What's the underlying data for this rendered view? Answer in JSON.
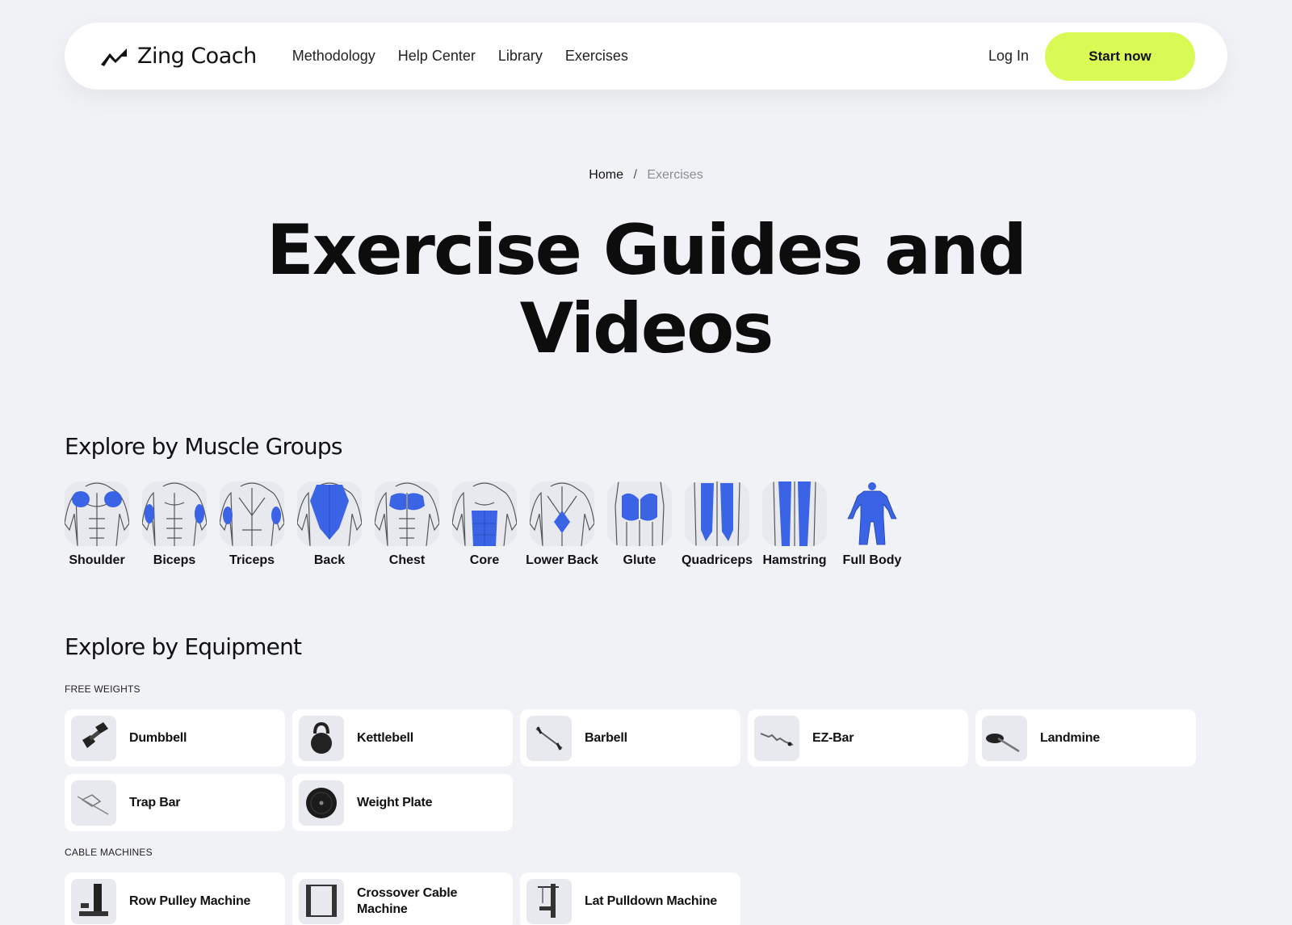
{
  "nav": {
    "brand": "Zing Coach",
    "links": [
      "Methodology",
      "Help Center",
      "Library",
      "Exercises"
    ],
    "login": "Log In",
    "cta": "Start now"
  },
  "breadcrumb": {
    "home": "Home",
    "separator": "/",
    "current": "Exercises"
  },
  "hero": {
    "line1": "Exercise Guides and",
    "line2": "Videos"
  },
  "muscle_section": {
    "title": "Explore by Muscle Groups",
    "items": [
      "Shoulder",
      "Biceps",
      "Triceps",
      "Back",
      "Chest",
      "Core",
      "Lower Back",
      "Glute",
      "Quadriceps",
      "Hamstring",
      "Full Body"
    ]
  },
  "equipment_section": {
    "title": "Explore by Equipment",
    "free_weights": {
      "heading": "FREE WEIGHTS",
      "items": [
        "Dumbbell",
        "Kettlebell",
        "Barbell",
        "EZ-Bar",
        "Landmine",
        "Trap Bar",
        "Weight Plate"
      ]
    },
    "cable_machines": {
      "heading": "CABLE MACHINES",
      "items": [
        "Row Pulley Machine",
        "Crossover Cable Machine",
        "Lat Pulldown Machine"
      ]
    }
  },
  "colors": {
    "background": "#f1f2f5",
    "accent": "#d9fa55",
    "muscle_highlight": "#3b63e6"
  }
}
